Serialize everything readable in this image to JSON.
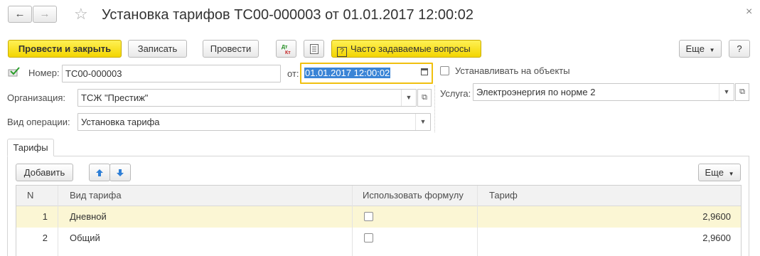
{
  "window": {
    "title": "Установка тарифов ТС00-000003 от 01.01.2017 12:00:02",
    "close_glyph": "×",
    "back_glyph": "←",
    "forward_glyph": "→",
    "star_glyph": "☆"
  },
  "toolbar": {
    "post_and_close": "Провести и закрыть",
    "save": "Записать",
    "post": "Провести",
    "faq": "Часто задаваемые вопросы",
    "more": "Еще",
    "help": "?"
  },
  "form": {
    "number_label": "Номер:",
    "number_value": "ТС00-000003",
    "date_label": "от:",
    "date_value": "01.01.2017 12:00:02",
    "org_label": "Организация:",
    "org_value": "ТСЖ \"Престиж\"",
    "op_label": "Вид операции:",
    "op_value": "Установка тарифа",
    "install_on_objects_label": "Устанавливать на объекты",
    "service_label": "Услуга:",
    "service_value": "Электроэнергия по норме 2"
  },
  "tabs": [
    {
      "label": "Тарифы"
    }
  ],
  "table_toolbar": {
    "add": "Добавить",
    "more": "Еще"
  },
  "table": {
    "columns": [
      "N",
      "Вид тарифа",
      "Использовать формулу",
      "Тариф"
    ],
    "rows": [
      {
        "n": "1",
        "type": "Дневной",
        "use_formula": false,
        "tariff": "2,9600"
      },
      {
        "n": "2",
        "type": "Общий",
        "use_formula": false,
        "tariff": "2,9600"
      }
    ]
  },
  "colors": {
    "accent_yellow": "#f3d500",
    "selected_row": "#fbf6d4",
    "focus_border": "#f0c010",
    "selection_blue": "#3a84d6"
  }
}
